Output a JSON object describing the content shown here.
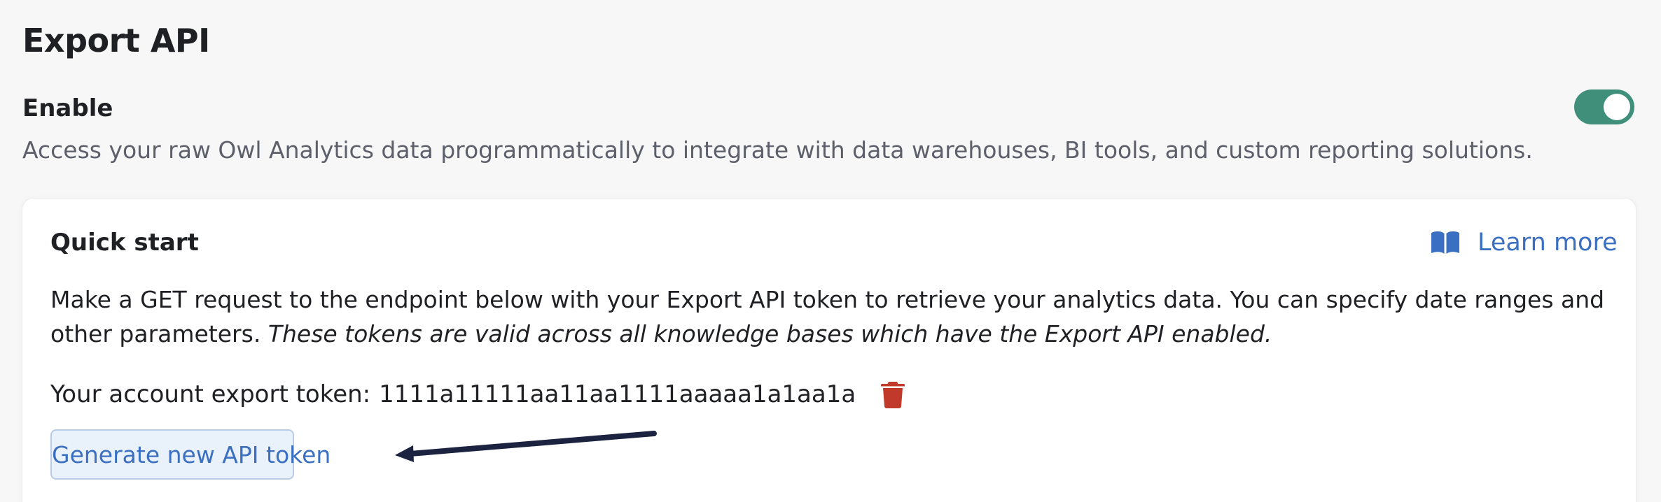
{
  "header": {
    "title": "Export API"
  },
  "enable": {
    "label": "Enable",
    "description": "Access your raw Owl Analytics data programmatically to integrate with data warehouses, BI tools, and custom reporting solutions.",
    "toggle_on": true,
    "toggle_color": "#3f8f7b"
  },
  "quick_start": {
    "title": "Quick start",
    "learn_more_label": "Learn more",
    "learn_more_icon": "book-open-icon",
    "description": "Make a GET request to the endpoint below with your Export API token to retrieve your analytics data. You can specify date ranges and other parameters.",
    "note": "These tokens are valid across all knowledge bases which have the Export API enabled.",
    "token_label": "Your account export token:",
    "token_value": "1111a11111aa11aa1111aaaaa1a1aa1a",
    "delete_icon": "trash-icon",
    "delete_color": "#c0392b",
    "generate_button_label": "Generate new API token",
    "link_color": "#3a6fc2"
  },
  "annotation": {
    "arrow_color": "#1c2340"
  }
}
